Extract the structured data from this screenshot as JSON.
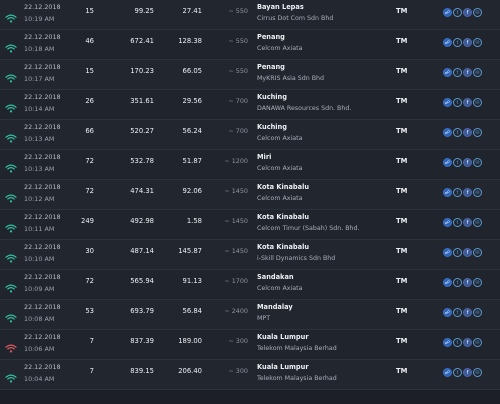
{
  "colors": {
    "wifi_good": "#2fc3a3",
    "wifi_weak": "#e05a63",
    "accent": "#5b9bd5"
  },
  "share_icons": [
    "link-icon",
    "twitter-icon",
    "facebook-icon",
    "email-icon"
  ],
  "rows": [
    {
      "date": "22.12.2018",
      "time": "10:19 AM",
      "ping": "15",
      "download": "99.25",
      "upload": "27.41",
      "distance": "~ 550",
      "server": "Bayan Lepas",
      "sponsor": "Cirrus Dot Com Sdn Bhd",
      "isp": "TM",
      "signal": "good"
    },
    {
      "date": "22.12.2018",
      "time": "10:18 AM",
      "ping": "46",
      "download": "672.41",
      "upload": "128.38",
      "distance": "~ 550",
      "server": "Penang",
      "sponsor": "Celcom Axiata",
      "isp": "TM",
      "signal": "good"
    },
    {
      "date": "22.12.2018",
      "time": "10:17 AM",
      "ping": "15",
      "download": "170.23",
      "upload": "66.05",
      "distance": "~ 550",
      "server": "Penang",
      "sponsor": "MyKRIS Asia Sdn Bhd",
      "isp": "TM",
      "signal": "good"
    },
    {
      "date": "22.12.2018",
      "time": "10:14 AM",
      "ping": "26",
      "download": "351.61",
      "upload": "29.56",
      "distance": "~ 700",
      "server": "Kuching",
      "sponsor": "DANAWA Resources Sdn. Bhd.",
      "isp": "TM",
      "signal": "good"
    },
    {
      "date": "22.12.2018",
      "time": "10:13 AM",
      "ping": "66",
      "download": "520.27",
      "upload": "56.24",
      "distance": "~ 700",
      "server": "Kuching",
      "sponsor": "Celcom Axiata",
      "isp": "TM",
      "signal": "good"
    },
    {
      "date": "22.12.2018",
      "time": "10:13 AM",
      "ping": "72",
      "download": "532.78",
      "upload": "51.87",
      "distance": "~ 1200",
      "server": "Miri",
      "sponsor": "Celcom Axiata",
      "isp": "TM",
      "signal": "good"
    },
    {
      "date": "22.12.2018",
      "time": "10:12 AM",
      "ping": "72",
      "download": "474.31",
      "upload": "92.06",
      "distance": "~ 1450",
      "server": "Kota Kinabalu",
      "sponsor": "Celcom Axiata",
      "isp": "TM",
      "signal": "good"
    },
    {
      "date": "22.12.2018",
      "time": "10:11 AM",
      "ping": "249",
      "download": "492.98",
      "upload": "1.58",
      "distance": "~ 1450",
      "server": "Kota Kinabalu",
      "sponsor": "Celcom Timur (Sabah) Sdn. Bhd.",
      "isp": "TM",
      "signal": "good"
    },
    {
      "date": "22.12.2018",
      "time": "10:10 AM",
      "ping": "30",
      "download": "487.14",
      "upload": "145.87",
      "distance": "~ 1450",
      "server": "Kota Kinabalu",
      "sponsor": "i-Skill Dynamics Sdn Bhd",
      "isp": "TM",
      "signal": "good"
    },
    {
      "date": "22.12.2018",
      "time": "10:09 AM",
      "ping": "72",
      "download": "565.94",
      "upload": "91.13",
      "distance": "~ 1700",
      "server": "Sandakan",
      "sponsor": "Celcom Axiata",
      "isp": "TM",
      "signal": "good"
    },
    {
      "date": "22.12.2018",
      "time": "10:08 AM",
      "ping": "53",
      "download": "693.79",
      "upload": "56.84",
      "distance": "~ 2400",
      "server": "Mandalay",
      "sponsor": "MPT",
      "isp": "TM",
      "signal": "good"
    },
    {
      "date": "22.12.2018",
      "time": "10:06 AM",
      "ping": "7",
      "download": "837.39",
      "upload": "189.00",
      "distance": "~ 300",
      "server": "Kuala Lumpur",
      "sponsor": "Telekom Malaysia Berhad",
      "isp": "TM",
      "signal": "weak"
    },
    {
      "date": "22.12.2018",
      "time": "10:04 AM",
      "ping": "7",
      "download": "839.15",
      "upload": "206.40",
      "distance": "~ 300",
      "server": "Kuala Lumpur",
      "sponsor": "Telekom Malaysia Berhad",
      "isp": "TM",
      "signal": "good"
    }
  ]
}
